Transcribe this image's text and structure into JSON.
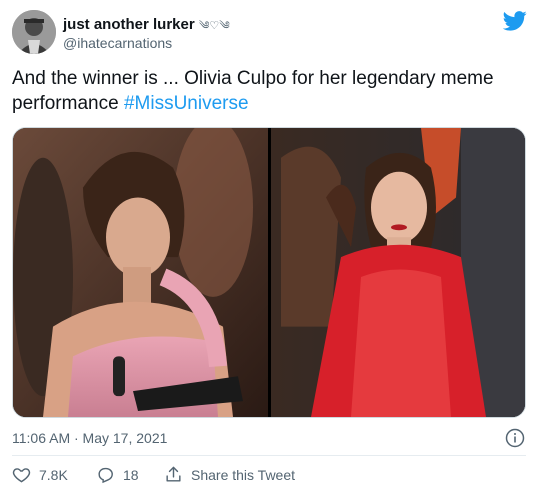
{
  "author": {
    "display_name": "just another lurker",
    "name_emoji": "༄♡༄",
    "handle": "@ihatecarnations"
  },
  "tweet": {
    "text": "And the winner is ... Olivia Culpo for her legendary meme performance ",
    "hashtag": "#MissUniverse"
  },
  "media": [
    {
      "icon": "photo-olivia-looking-down"
    },
    {
      "icon": "photo-olivia-red-dress"
    }
  ],
  "meta": {
    "timestamp": "11:06 AM · May 17, 2021"
  },
  "actions": {
    "likes": "7.8K",
    "replies": "18",
    "share_label": "Share this Tweet"
  },
  "colors": {
    "accent": "#1d9bf0",
    "text": "#0f1419",
    "secondary": "#536471"
  }
}
